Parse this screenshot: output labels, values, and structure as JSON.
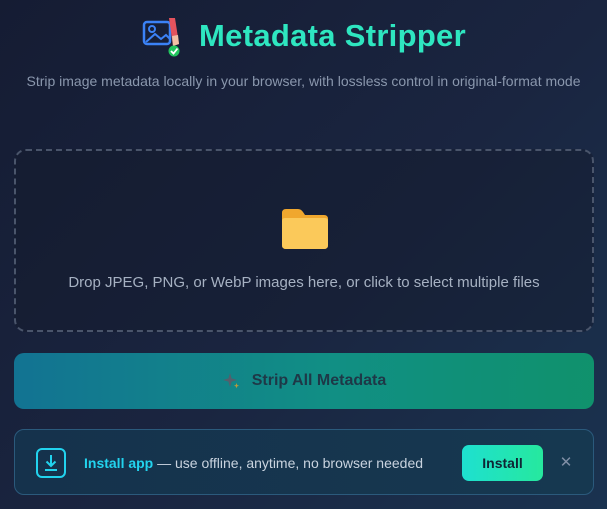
{
  "header": {
    "title": "Metadata Stripper",
    "subtitle": "Strip image metadata locally in your browser, with lossless control in original-format mode",
    "logo_icon": "image-eraser-check-icon"
  },
  "dropzone": {
    "icon": "folder-icon",
    "text": "Drop JPEG, PNG, or WebP images here, or click to select multiple files"
  },
  "strip_button": {
    "icon": "sparkles-icon",
    "label": "Strip All Metadata"
  },
  "install_bar": {
    "icon": "download-icon",
    "title": "Install app",
    "description": " — use offline, anytime, no browser needed",
    "button_label": "Install",
    "close_label": "✕"
  },
  "colors": {
    "accent": "#2ee6c0",
    "link": "#22d3ee",
    "folder": "#f7b73a"
  }
}
